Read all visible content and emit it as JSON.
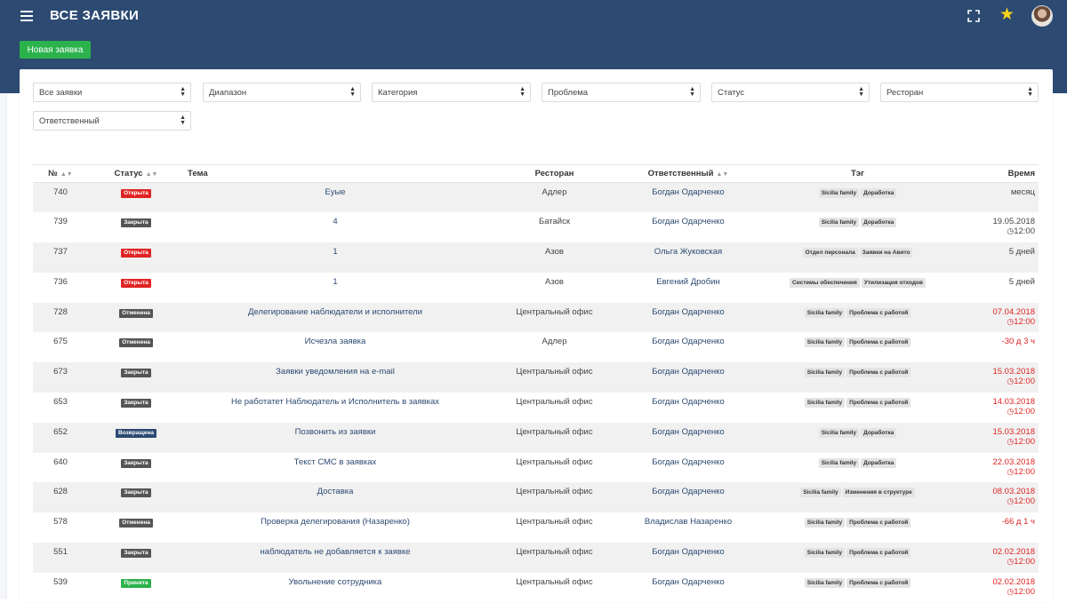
{
  "header": {
    "title": "ВСЕ ЗАЯВКИ",
    "new_button": "Новая заявка",
    "icons": [
      "menu-icon",
      "expand-icon",
      "star-icon",
      "avatar"
    ],
    "colors": {
      "topbar": "#2c4a72",
      "accent_green": "#2bb24c",
      "danger": "#e02424"
    }
  },
  "filters": {
    "all": "Все заявки",
    "range": "Диапазон",
    "category": "Категория",
    "problem": "Проблема",
    "status": "Статус",
    "restaurant": "Ресторан",
    "assignee": "Ответственный"
  },
  "table": {
    "headers": {
      "num": "№",
      "status": "Статус",
      "subject": "Тема",
      "restaurant": "Ресторан",
      "assignee": "Ответственный",
      "tag": "Тэг",
      "time": "Время"
    },
    "rows": [
      {
        "num": "740",
        "status": "Открыта",
        "status_class": "b-open",
        "subject": "Еуые",
        "restaurant": "Адлер",
        "assignee": "Богдан Одарченко",
        "tags": [
          "Sicilia family",
          "Доработка"
        ],
        "time": "месяц",
        "time2": "",
        "overdue": false
      },
      {
        "num": "739",
        "status": "Закрыта",
        "status_class": "b-closed",
        "subject": "4",
        "restaurant": "Батайск",
        "assignee": "Богдан Одарченко",
        "tags": [
          "Sicilia family",
          "Доработка"
        ],
        "time": "19.05.2018",
        "time2": "12:00",
        "overdue": false
      },
      {
        "num": "737",
        "status": "Открыта",
        "status_class": "b-open",
        "subject": "1",
        "restaurant": "Азов",
        "assignee": "Ольга Жуковская",
        "tags": [
          "Отдел персонала",
          "Заявки на Авито"
        ],
        "time": "5 дней",
        "time2": "",
        "overdue": false
      },
      {
        "num": "736",
        "status": "Открыта",
        "status_class": "b-open",
        "subject": "1",
        "restaurant": "Азов",
        "assignee": "Евгений Дробин",
        "tags": [
          "Системы обеспечения",
          "Утилизация отходов"
        ],
        "time": "5 дней",
        "time2": "",
        "overdue": false
      },
      {
        "num": "728",
        "status": "Отменена",
        "status_class": "b-cancel",
        "subject": "Делегирование наблюдатели и исполнители",
        "restaurant": "Центральный офис",
        "assignee": "Богдан Одарченко",
        "tags": [
          "Sicilia family",
          "Проблема с работой"
        ],
        "time": "07.04.2018",
        "time2": "12:00",
        "overdue": true
      },
      {
        "num": "675",
        "status": "Отменена",
        "status_class": "b-cancel",
        "subject": "Исчезла заявка",
        "restaurant": "Адлер",
        "assignee": "Богдан Одарченко",
        "tags": [
          "Sicilia family",
          "Проблема с работой"
        ],
        "time": "-30 д 3 ч",
        "time2": "",
        "overdue": true
      },
      {
        "num": "673",
        "status": "Закрыта",
        "status_class": "b-closed",
        "subject": "Заявки уведомления на e-mail",
        "restaurant": "Центральный офис",
        "assignee": "Богдан Одарченко",
        "tags": [
          "Sicilia family",
          "Проблема с работой"
        ],
        "time": "15.03.2018",
        "time2": "12:00",
        "overdue": true
      },
      {
        "num": "653",
        "status": "Закрыта",
        "status_class": "b-closed",
        "subject": "Не работатет Наблюдатель и Исполнитель в заявках",
        "restaurant": "Центральный офис",
        "assignee": "Богдан Одарченко",
        "tags": [
          "Sicilia family",
          "Проблема с работой"
        ],
        "time": "14.03.2018",
        "time2": "12:00",
        "overdue": true
      },
      {
        "num": "652",
        "status": "Возвращена",
        "status_class": "b-return",
        "subject": "Позвонить из заявки",
        "restaurant": "Центральный офис",
        "assignee": "Богдан Одарченко",
        "tags": [
          "Sicilia family",
          "Доработка"
        ],
        "time": "15.03.2018",
        "time2": "12:00",
        "overdue": true
      },
      {
        "num": "640",
        "status": "Закрыта",
        "status_class": "b-closed",
        "subject": "Текст СМС в заявках",
        "restaurant": "Центральный офис",
        "assignee": "Богдан Одарченко",
        "tags": [
          "Sicilia family",
          "Доработка"
        ],
        "time": "22.03.2018",
        "time2": "12:00",
        "overdue": true
      },
      {
        "num": "628",
        "status": "Закрыта",
        "status_class": "b-closed",
        "subject": "Доставка",
        "restaurant": "Центральный офис",
        "assignee": "Богдан Одарченко",
        "tags": [
          "Sicilia family",
          "Изменения в структуре"
        ],
        "time": "08.03.2018",
        "time2": "12:00",
        "overdue": true
      },
      {
        "num": "578",
        "status": "Отменена",
        "status_class": "b-cancel",
        "subject": "Проверка делегирования (Назаренко)",
        "restaurant": "Центральный офис",
        "assignee": "Владислав Назаренко",
        "tags": [
          "Sicilia family",
          "Проблема с работой"
        ],
        "time": "-66 д 1 ч",
        "time2": "",
        "overdue": true
      },
      {
        "num": "551",
        "status": "Закрыта",
        "status_class": "b-closed",
        "subject": "наблюдатель не добавляется к заявке",
        "restaurant": "Центральный офис",
        "assignee": "Богдан Одарченко",
        "tags": [
          "Sicilia family",
          "Проблема с работой"
        ],
        "time": "02.02.2018",
        "time2": "12:00",
        "overdue": true
      },
      {
        "num": "539",
        "status": "Принята",
        "status_class": "b-accept",
        "subject": "Увольнение сотрудника",
        "restaurant": "Центральный офис",
        "assignee": "Богдан Одарченко",
        "tags": [
          "Sicilia family",
          "Проблема с работой"
        ],
        "time": "02.02.2018",
        "time2": "12:00",
        "overdue": true
      }
    ]
  }
}
